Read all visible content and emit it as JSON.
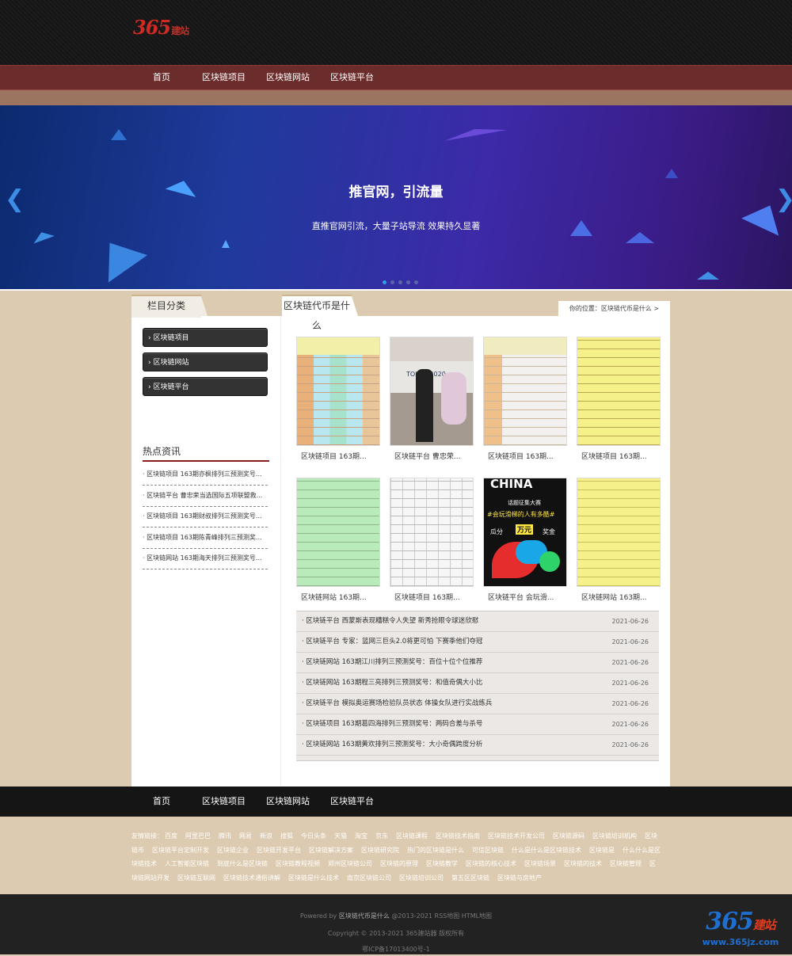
{
  "header": {
    "logo_num": "365",
    "logo_text": "建站"
  },
  "nav": {
    "items": [
      "首页",
      "区块链项目",
      "区块链网站",
      "区块链平台"
    ]
  },
  "banner": {
    "title": "推官网，引流量",
    "subtitle": "直推官网引流，大量子站导流 效果持久显著",
    "slide_count": 5,
    "active_slide": 1
  },
  "tabs": {
    "category": "栏目分类",
    "current": "区块链代币是什么"
  },
  "breadcrumb": "你的位置：区块链代币是什么 >",
  "sidebar": {
    "items": [
      "区块链项目",
      "区块链网站",
      "区块链平台"
    ],
    "hot_title": "热点资讯",
    "hot_items": [
      "区块链项目 163期亦枫排列三预测奖号...",
      "区块链平台 曹忠荣当选国际五项联盟救...",
      "区块链项目 163期财叔排列三预测奖号...",
      "区块链项目 163期陈青峰排列三预测奖...",
      "区块链网站 163期海天排列三预测奖号..."
    ]
  },
  "grid": {
    "captions": [
      "区块链项目 163期...",
      "区块链平台 曹忠荣...",
      "区块链项目 163期...",
      "区块链项目 163期...",
      "区块链网站 163期...",
      "区块链项目 163期...",
      "区块链平台 会玩滑...",
      "区块链网站 163期..."
    ],
    "poster_text": [
      "CHINA",
      "话题征集大赛",
      "#会玩滑梯的人有多酷#",
      "瓜分",
      "万元",
      "奖金"
    ],
    "photo_text": "TOKYO 2020"
  },
  "news": [
    {
      "title": "区块链平台 西蒙斯表现糟糕令人失望 新秀抢眼令球迷欣慰",
      "date": "2021-06-26"
    },
    {
      "title": "区块链平台 专家：篮网三巨头2.0将更可怕 下赛季他们夺冠",
      "date": "2021-06-26"
    },
    {
      "title": "区块链网站 163期江川排列三预测奖号：百位十位个位推荐",
      "date": "2021-06-26"
    },
    {
      "title": "区块链网站 163期程三亮排列三预测奖号：和值奇偶大小比",
      "date": "2021-06-26"
    },
    {
      "title": "区块链平台 模拟奥运赛场检验队员状态 体操女队进行实战练兵",
      "date": "2021-06-26"
    },
    {
      "title": "区块链项目 163期葛四海排列三预测奖号：两码合差与杀号",
      "date": "2021-06-26"
    },
    {
      "title": "区块链网站 163期黄欢排列三预测奖号：大小奇偶跨度分析",
      "date": "2021-06-26"
    }
  ],
  "footer_nav": [
    "首页",
    "区块链项目",
    "区块链网站",
    "区块链平台"
  ],
  "links": {
    "label": "友情链接：",
    "items": [
      "百度",
      "阿里巴巴",
      "腾讯",
      "网易",
      "新浪",
      "搜狐",
      "今日头条",
      "天猫",
      "淘宝",
      "京东",
      "区块链课程",
      "区块链技术指南",
      "区块链技术开发公司",
      "区块链源码",
      "区块链培训机构",
      "区块链币",
      "区块链平台定制开发",
      "区块链企业",
      "区块链开发平台",
      "区块链解决方案",
      "区块链研究院",
      "热门的区块链是什么",
      "可信区块链",
      "什么是什么是区块链技术",
      "区块链是",
      "什么什么是区块链技术",
      "人工智能区块链",
      "到底什么是区块链",
      "区块链教程视频",
      "郑州区块链公司",
      "区块链的原理",
      "区块链教学",
      "区块链的核心技术",
      "区块链场景",
      "区块链的技术",
      "区块链管理",
      "区块链网站开发",
      "区块链互联网",
      "区块链技术通俗讲解",
      "区块链是什么技术",
      "南京区块链公司",
      "区块链培训公司",
      "第五区区块链",
      "区块链与房地产"
    ]
  },
  "bottom": {
    "powered_prefix": "Powered by ",
    "site_name": "区块链代币是什么",
    "powered_suffix": " @2013-2021 RSS地图 HTML地图",
    "copyright": "Copyright © 2013-2021 365建站器 版权所有",
    "icp": "鄂ICP备17013400号-1"
  },
  "watermark": {
    "num": "365",
    "text": "建站",
    "url": "www.365jz.com"
  }
}
